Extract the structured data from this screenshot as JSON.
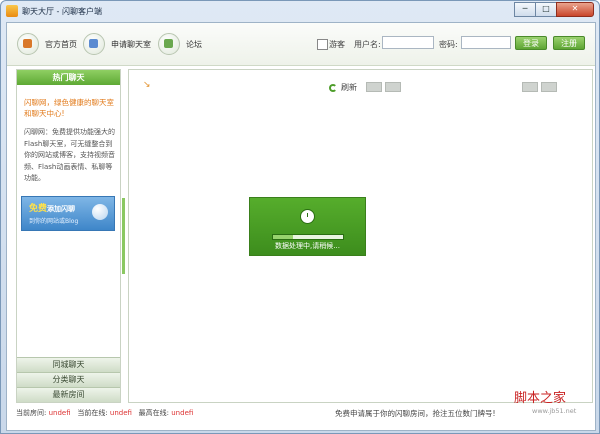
{
  "window": {
    "title": "聊天大厅 - 闪聊客户端",
    "controls": [
      "─",
      "□",
      "✕"
    ]
  },
  "toolbar": {
    "nav": [
      {
        "label": "官方首页",
        "icon": "home-icon",
        "color": "#d9782a"
      },
      {
        "label": "申请聊天室",
        "icon": "apply-room-icon",
        "color": "#5b8bd1"
      },
      {
        "label": "论坛",
        "icon": "forum-icon",
        "color": "#6aa84f"
      }
    ],
    "guest_label": "游客",
    "username_label": "用户名:",
    "password_label": "密码:",
    "login_label": "登录",
    "register_label": "注册"
  },
  "sidebar": {
    "header": "热门聊天",
    "slogan": "闪聊网，绿色健康的聊天室和聊天中心!",
    "description": "闪聊网：免费提供功能强大的Flash聊天室，可无缝整合到你的网站或博客，支持视频音频、Flash动画表情、私聊等功能。",
    "banner": {
      "free": "免费",
      "line1": "添加闪聊",
      "line2": "到你的网站或Blog"
    },
    "tabs": [
      "同城聊天",
      "分类聊天",
      "最新房间"
    ]
  },
  "main": {
    "refresh_label": "刷新",
    "loading_text": "数据处理中,请稍候...",
    "loading_progress": 0.28
  },
  "statusbar": {
    "rooms_label": "当前房间:",
    "rooms_value": "undefi",
    "online_label": "当前在线:",
    "online_value": "undefi",
    "max_label": "最高在线:",
    "max_value": "undefi",
    "promo": "免费申请属于你的闪聊房间，抢注五位数门牌号!"
  },
  "watermark": {
    "title": "脚本之家",
    "site": "www.jb51.net"
  }
}
